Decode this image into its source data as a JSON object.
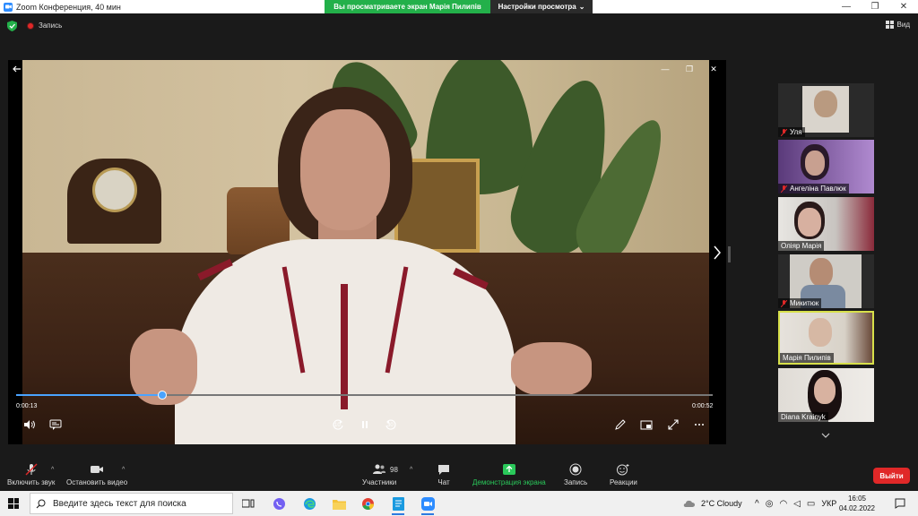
{
  "window": {
    "title": "Zoom Конференция, 40 мин",
    "minimize": "—",
    "maximize": "❐",
    "close": "✕"
  },
  "share_banner": {
    "viewing": "Вы просматриваете экран Марія Пилипів",
    "view_settings": "Настройки просмотра"
  },
  "top": {
    "recording_label": "Запись",
    "view_label": "Вид"
  },
  "player": {
    "current_time": "0:00:13",
    "total_time": "0:00:52",
    "progress": 0.21,
    "rewind_label": "10",
    "forward_label": "30"
  },
  "participants": [
    {
      "name": "Уля",
      "muted": true
    },
    {
      "name": "Ангеліна Павлюк",
      "muted": true
    },
    {
      "name": "Оліяр Марія",
      "muted": false
    },
    {
      "name": "Микитюк",
      "muted": true
    },
    {
      "name": "Марія Пилипів",
      "muted": false,
      "active": true
    },
    {
      "name": "Diana Krainyk",
      "muted": false
    }
  ],
  "toolbar": {
    "mute_label": "Включить звук",
    "video_label": "Остановить видео",
    "participants_label": "Участники",
    "participants_count": "98",
    "chat_label": "Чат",
    "share_label": "Демонстрация экрана",
    "record_label": "Запись",
    "reactions_label": "Реакции",
    "leave_label": "Выйти"
  },
  "taskbar": {
    "search_placeholder": "Введите здесь текст для поиска",
    "weather": "2°C  Cloudy",
    "language": "УКР",
    "time": "16:05",
    "date": "04.02.2022"
  },
  "colors": {
    "accent": "#2d8cff",
    "share_green": "#23b04a",
    "leave_red": "#e02828",
    "active_border": "#d7e04a"
  }
}
